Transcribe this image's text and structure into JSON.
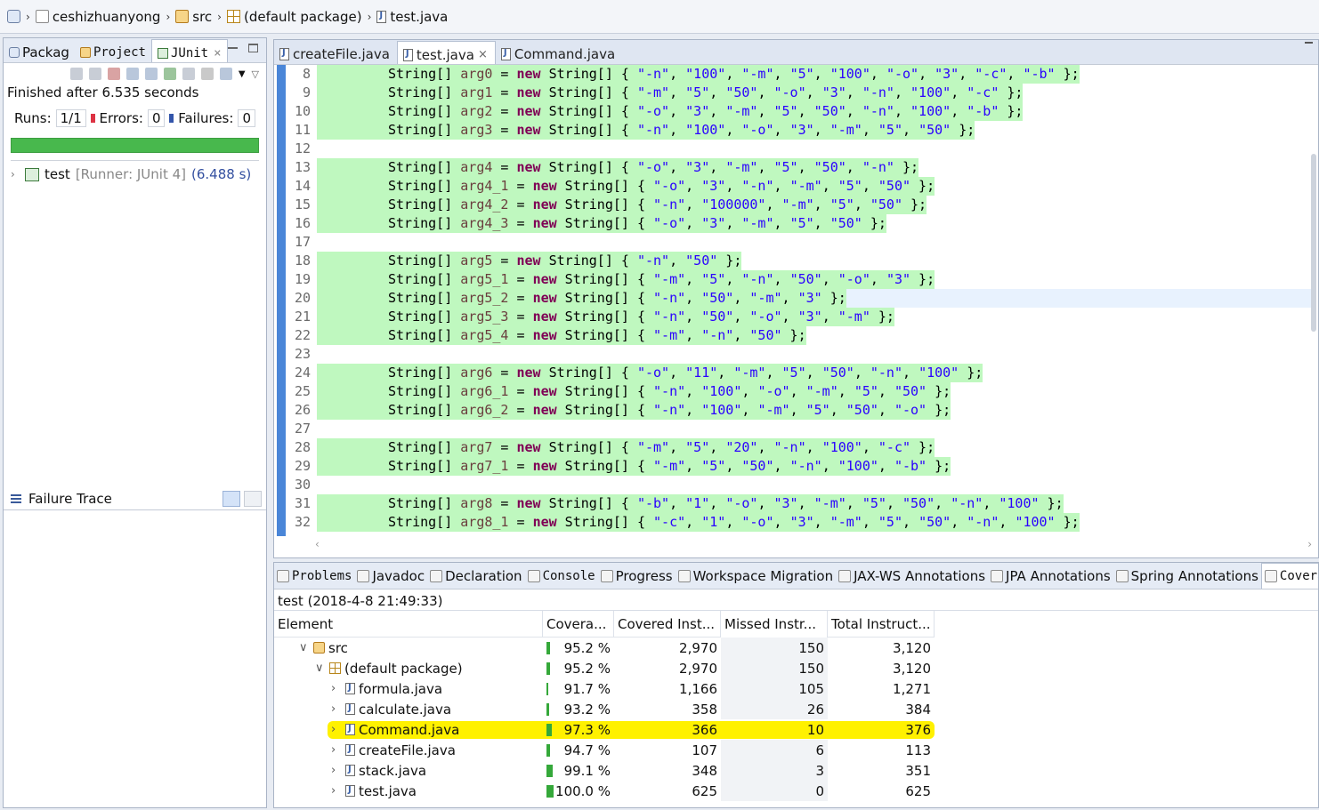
{
  "breadcrumb": {
    "items": [
      "ceshizhuanyong",
      "src",
      "(default package)",
      "test.java"
    ]
  },
  "left_panel": {
    "tabs": [
      "Packag",
      "Project",
      "JUnit"
    ],
    "finished": "Finished after 6.535 seconds",
    "runs_label": "Runs:",
    "runs_value": "1/1",
    "errors_label": "Errors:",
    "errors_value": "0",
    "failures_label": "Failures:",
    "failures_value": "0",
    "progress": 1.0,
    "progress_color": "#48b84d",
    "test_name": "test",
    "runner": "[Runner: JUnit 4]",
    "time": "(6.488 s)",
    "failure_trace": "Failure Trace"
  },
  "editor": {
    "tabs": [
      "createFile.java",
      "test.java",
      "Command.java"
    ],
    "active_tab": "test.java",
    "lines": [
      {
        "n": "8",
        "var": "arg0",
        "args": [
          "\"-n\"",
          "\"100\"",
          "\"-m\"",
          "\"5\"",
          "\"100\"",
          "\"-o\"",
          "\"3\"",
          "\"-c\"",
          "\"-b\""
        ]
      },
      {
        "n": "9",
        "var": "arg1",
        "args": [
          "\"-m\"",
          "\"5\"",
          "\"50\"",
          "\"-o\"",
          "\"3\"",
          "\"-n\"",
          "\"100\"",
          "\"-c\""
        ]
      },
      {
        "n": "10",
        "var": "arg2",
        "args": [
          "\"-o\"",
          "\"3\"",
          "\"-m\"",
          "\"5\"",
          "\"50\"",
          "\"-n\"",
          "\"100\"",
          "\"-b\""
        ]
      },
      {
        "n": "11",
        "var": "arg3",
        "args": [
          "\"-n\"",
          "\"100\"",
          "\"-o\"",
          "\"3\"",
          "\"-m\"",
          "\"5\"",
          "\"50\""
        ]
      },
      {
        "n": "12",
        "blank": true
      },
      {
        "n": "13",
        "var": "arg4",
        "args": [
          "\"-o\"",
          "\"3\"",
          "\"-m\"",
          "\"5\"",
          "\"50\"",
          "\"-n\""
        ]
      },
      {
        "n": "14",
        "var": "arg4_1",
        "args": [
          "\"-o\"",
          "\"3\"",
          "\"-n\"",
          "\"-m\"",
          "\"5\"",
          "\"50\""
        ]
      },
      {
        "n": "15",
        "var": "arg4_2",
        "args": [
          "\"-n\"",
          "\"100000\"",
          "\"-m\"",
          "\"5\"",
          "\"50\""
        ]
      },
      {
        "n": "16",
        "var": "arg4_3",
        "args": [
          "\"-o\"",
          "\"3\"",
          "\"-m\"",
          "\"5\"",
          "\"50\""
        ]
      },
      {
        "n": "17",
        "blank": true
      },
      {
        "n": "18",
        "var": "arg5",
        "args": [
          "\"-n\"",
          "\"50\""
        ]
      },
      {
        "n": "19",
        "var": "arg5_1",
        "args": [
          "\"-m\"",
          "\"5\"",
          "\"-n\"",
          "\"50\"",
          "\"-o\"",
          "\"3\""
        ]
      },
      {
        "n": "20",
        "var": "arg5_2",
        "args": [
          "\"-n\"",
          "\"50\"",
          "\"-m\"",
          "\"3\""
        ],
        "current": true
      },
      {
        "n": "21",
        "var": "arg5_3",
        "args": [
          "\"-n\"",
          "\"50\"",
          "\"-o\"",
          "\"3\"",
          "\"-m\""
        ]
      },
      {
        "n": "22",
        "var": "arg5_4",
        "args": [
          "\"-m\"",
          "\"-n\"",
          "\"50\""
        ]
      },
      {
        "n": "23",
        "blank": true
      },
      {
        "n": "24",
        "var": "arg6",
        "args": [
          "\"-o\"",
          "\"11\"",
          "\"-m\"",
          "\"5\"",
          "\"50\"",
          "\"-n\"",
          "\"100\""
        ]
      },
      {
        "n": "25",
        "var": "arg6_1",
        "args": [
          "\"-n\"",
          "\"100\"",
          "\"-o\"",
          "\"-m\"",
          "\"5\"",
          "\"50\""
        ]
      },
      {
        "n": "26",
        "var": "arg6_2",
        "args": [
          "\"-n\"",
          "\"100\"",
          "\"-m\"",
          "\"5\"",
          "\"50\"",
          "\"-o\""
        ]
      },
      {
        "n": "27",
        "blank": true
      },
      {
        "n": "28",
        "var": "arg7",
        "args": [
          "\"-m\"",
          "\"5\"",
          "\"20\"",
          "\"-n\"",
          "\"100\"",
          "\"-c\""
        ]
      },
      {
        "n": "29",
        "var": "arg7_1",
        "args": [
          "\"-m\"",
          "\"5\"",
          "\"50\"",
          "\"-n\"",
          "\"100\"",
          "\"-b\""
        ]
      },
      {
        "n": "30",
        "blank": true
      },
      {
        "n": "31",
        "var": "arg8",
        "args": [
          "\"-b\"",
          "\"1\"",
          "\"-o\"",
          "\"3\"",
          "\"-m\"",
          "\"5\"",
          "\"50\"",
          "\"-n\"",
          "\"100\""
        ]
      },
      {
        "n": "32",
        "var": "arg8_1",
        "args": [
          "\"-c\"",
          "\"1\"",
          "\"-o\"",
          "\"3\"",
          "\"-m\"",
          "\"5\"",
          "\"50\"",
          "\"-n\"",
          "\"100\""
        ]
      }
    ],
    "coverage_color": "#bff8bf"
  },
  "bottom_panel": {
    "tabs": [
      {
        "label": "Problems",
        "mono": true
      },
      {
        "label": "Javadoc"
      },
      {
        "label": "Declaration"
      },
      {
        "label": "Console",
        "mono": true
      },
      {
        "label": "Progress"
      },
      {
        "label": "Workspace Migration"
      },
      {
        "label": "JAX-WS Annotations"
      },
      {
        "label": "JPA Annotations"
      },
      {
        "label": "Spring Annotations"
      },
      {
        "label": "Coverag",
        "mono": true,
        "active": true
      }
    ],
    "session": "test (2018-4-8 21:49:33)",
    "columns": [
      "Element",
      "Covera...",
      "Covered Inst...",
      "Missed Instr...",
      "Total Instruct..."
    ],
    "rows": [
      {
        "indent": 1,
        "expander": "∨",
        "icon": "srcfolder",
        "name": "src",
        "coverage": "95.2 %",
        "covered": "2,970",
        "missed": "150",
        "total": "3,120",
        "bar": 0.952
      },
      {
        "indent": 2,
        "expander": "∨",
        "icon": "package",
        "name": "(default package)",
        "coverage": "95.2 %",
        "covered": "2,970",
        "missed": "150",
        "total": "3,120",
        "bar": 0.952
      },
      {
        "indent": 3,
        "expander": "›",
        "icon": "java",
        "name": "formula.java",
        "coverage": "91.7 %",
        "covered": "1,166",
        "missed": "105",
        "total": "1,271",
        "bar": 0.917
      },
      {
        "indent": 3,
        "expander": "›",
        "icon": "java",
        "name": "calculate.java",
        "coverage": "93.2 %",
        "covered": "358",
        "missed": "26",
        "total": "384",
        "bar": 0.932
      },
      {
        "indent": 3,
        "expander": "›",
        "icon": "java",
        "name": "Command.java",
        "coverage": "97.3 %",
        "covered": "366",
        "missed": "10",
        "total": "376",
        "bar": 0.973,
        "highlight": true
      },
      {
        "indent": 3,
        "expander": "›",
        "icon": "java",
        "name": "createFile.java",
        "coverage": "94.7 %",
        "covered": "107",
        "missed": "6",
        "total": "113",
        "bar": 0.947
      },
      {
        "indent": 3,
        "expander": "›",
        "icon": "java",
        "name": "stack.java",
        "coverage": "99.1 %",
        "covered": "348",
        "missed": "3",
        "total": "351",
        "bar": 0.991
      },
      {
        "indent": 3,
        "expander": "›",
        "icon": "java",
        "name": "test.java",
        "coverage": "100.0 %",
        "covered": "625",
        "missed": "0",
        "total": "625",
        "bar": 1.0
      }
    ],
    "highlight_color": "#fff100",
    "bar_color": "#35a83a"
  }
}
